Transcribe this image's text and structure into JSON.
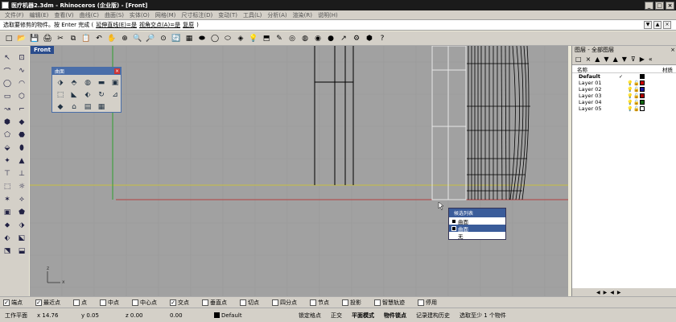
{
  "title": "医疗机器2.3dm - Rhinoceros (企业版) - [Front]",
  "window_buttons": [
    "_",
    "□",
    "×"
  ],
  "menu": [
    "文件(F)",
    "编辑(E)",
    "查看(V)",
    "曲线(C)",
    "曲面(S)",
    "实体(O)",
    "网格(M)",
    "尺寸标注(D)",
    "变动(T)",
    "工具(L)",
    "分析(A)",
    "渲染(R)",
    "说明(H)"
  ],
  "command": {
    "prompt": "选取要修剪的物件。按 Enter 完成 (",
    "opt1": "延伸直线(E)=是",
    "opt2": "视角交点(A)=是",
    "opt3": "复原",
    "tail": ")"
  },
  "cmd_controls": [
    "▼",
    "▲",
    "×"
  ],
  "toolbar_icons": [
    "□",
    "📂",
    "💾",
    "🖨",
    "✂",
    "⧉",
    "📋",
    "↶",
    "✋",
    "⊕",
    "🔍",
    "🔎",
    "⊙",
    "🔄",
    "▦",
    "⬬",
    "◯",
    "⬭",
    "◈",
    "💡",
    "⬒",
    "✎",
    "◎",
    "◍",
    "◉",
    "●",
    "↗",
    "⚙",
    "⬢",
    "?"
  ],
  "left_icons": [
    "↖",
    "⊡",
    "⌒",
    "∿",
    "◯",
    "◠",
    "▭",
    "⬡",
    "↝",
    "⌐",
    "⬢",
    "◆",
    "⬠",
    "⬣",
    "⬙",
    "⬮",
    "✦",
    "▲",
    "⊤",
    "⊥",
    "⬚",
    "☼",
    "✶",
    "⟡",
    "▣",
    "⬟",
    "⬥",
    "⬗",
    "⬖",
    "⬕",
    "⬔",
    "⬓"
  ],
  "viewport": {
    "label": "Front",
    "axis_z": "z",
    "axis_x": "x"
  },
  "surface_panel": {
    "title": "曲面",
    "icons": [
      "⬗",
      "⬘",
      "◍",
      "▬",
      "▣",
      "⬚",
      "◣",
      "⬖",
      "↻",
      "⊿",
      "◆",
      "⌂",
      "▤",
      "▦"
    ]
  },
  "filter_list": {
    "title": "候选列表",
    "items": [
      "曲面",
      "曲面",
      "无"
    ]
  },
  "layers": {
    "title": "图层 - 全部图层",
    "tools": [
      "□",
      "×",
      "▲",
      "▼",
      "▲",
      "▼",
      "⊽",
      "▶",
      "«"
    ],
    "header_name": "名称",
    "header_mat": "材质",
    "rows": [
      {
        "name": "Default",
        "current": "✓",
        "color": "#000000"
      },
      {
        "name": "Layer 01",
        "current": "",
        "color": "#cc0000"
      },
      {
        "name": "Layer 02",
        "current": "",
        "color": "#1a1aa0"
      },
      {
        "name": "Layer 03",
        "current": "",
        "color": "#b00000"
      },
      {
        "name": "Layer 04",
        "current": "",
        "color": "#116611"
      },
      {
        "name": "Layer 05",
        "current": "",
        "color": "#ffffff"
      }
    ],
    "footer": [
      "◀",
      "▶",
      "◀",
      "▶"
    ]
  },
  "osnaps": [
    {
      "label": "端点",
      "checked": true
    },
    {
      "label": "最近点",
      "checked": true
    },
    {
      "label": "点",
      "checked": false
    },
    {
      "label": "中点",
      "checked": false
    },
    {
      "label": "中心点",
      "checked": false
    },
    {
      "label": "交点",
      "checked": true
    },
    {
      "label": "垂直点",
      "checked": false
    },
    {
      "label": "切点",
      "checked": false
    },
    {
      "label": "四分点",
      "checked": false
    },
    {
      "label": "节点",
      "checked": false
    },
    {
      "label": "投影",
      "checked": false
    },
    {
      "label": "智慧轨迹",
      "checked": false
    },
    {
      "label": "停用",
      "checked": false
    }
  ],
  "status": {
    "cplane": "工作平面",
    "x": "x 14.76",
    "y": "y 0.05",
    "z": "z 0.00",
    "zv": "0.00",
    "layer": "Default",
    "grid_snap": "锁定格点",
    "ortho": "正交",
    "planar": "平面模式",
    "osnap": "物件锁点",
    "history": "记录建构历史",
    "select": "选取至少 1 个物件"
  }
}
